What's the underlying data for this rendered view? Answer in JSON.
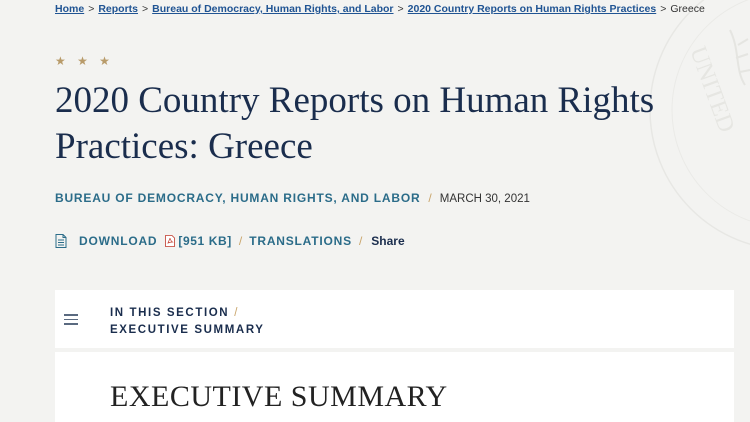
{
  "breadcrumb": {
    "items": [
      {
        "label": "Home"
      },
      {
        "label": "Reports"
      },
      {
        "label": "Bureau of Democracy, Human Rights, and Labor"
      },
      {
        "label": "2020 Country Reports on Human Rights Practices"
      }
    ],
    "current": "Greece",
    "separator": ">"
  },
  "header": {
    "stars": "★ ★ ★",
    "title": "2020 Country Reports on Human Rights Practices: Greece",
    "bureau": "BUREAU OF DEMOCRACY, HUMAN RIGHTS, AND LABOR",
    "date": "MARCH 30, 2021",
    "slash": "/"
  },
  "actions": {
    "download_label": "DOWNLOAD",
    "file_size": "[951 KB]",
    "translations_label": "TRANSLATIONS",
    "share_label": "Share",
    "slash": "/"
  },
  "section_nav": {
    "in_this_section": "IN THIS SECTION",
    "current_section": "EXECUTIVE SUMMARY",
    "slash": "/"
  },
  "content": {
    "heading": "EXECUTIVE SUMMARY"
  },
  "colors": {
    "title": "#1a2d4d",
    "link": "#205493",
    "accent_gold": "#c9a56b",
    "teal_link": "#2b6c89",
    "background": "#f3f3f1"
  },
  "icons": {
    "download": "document-icon",
    "pdf": "pdf-file-icon",
    "menu": "hamburger-menu-icon",
    "seal": "watermark-seal"
  }
}
